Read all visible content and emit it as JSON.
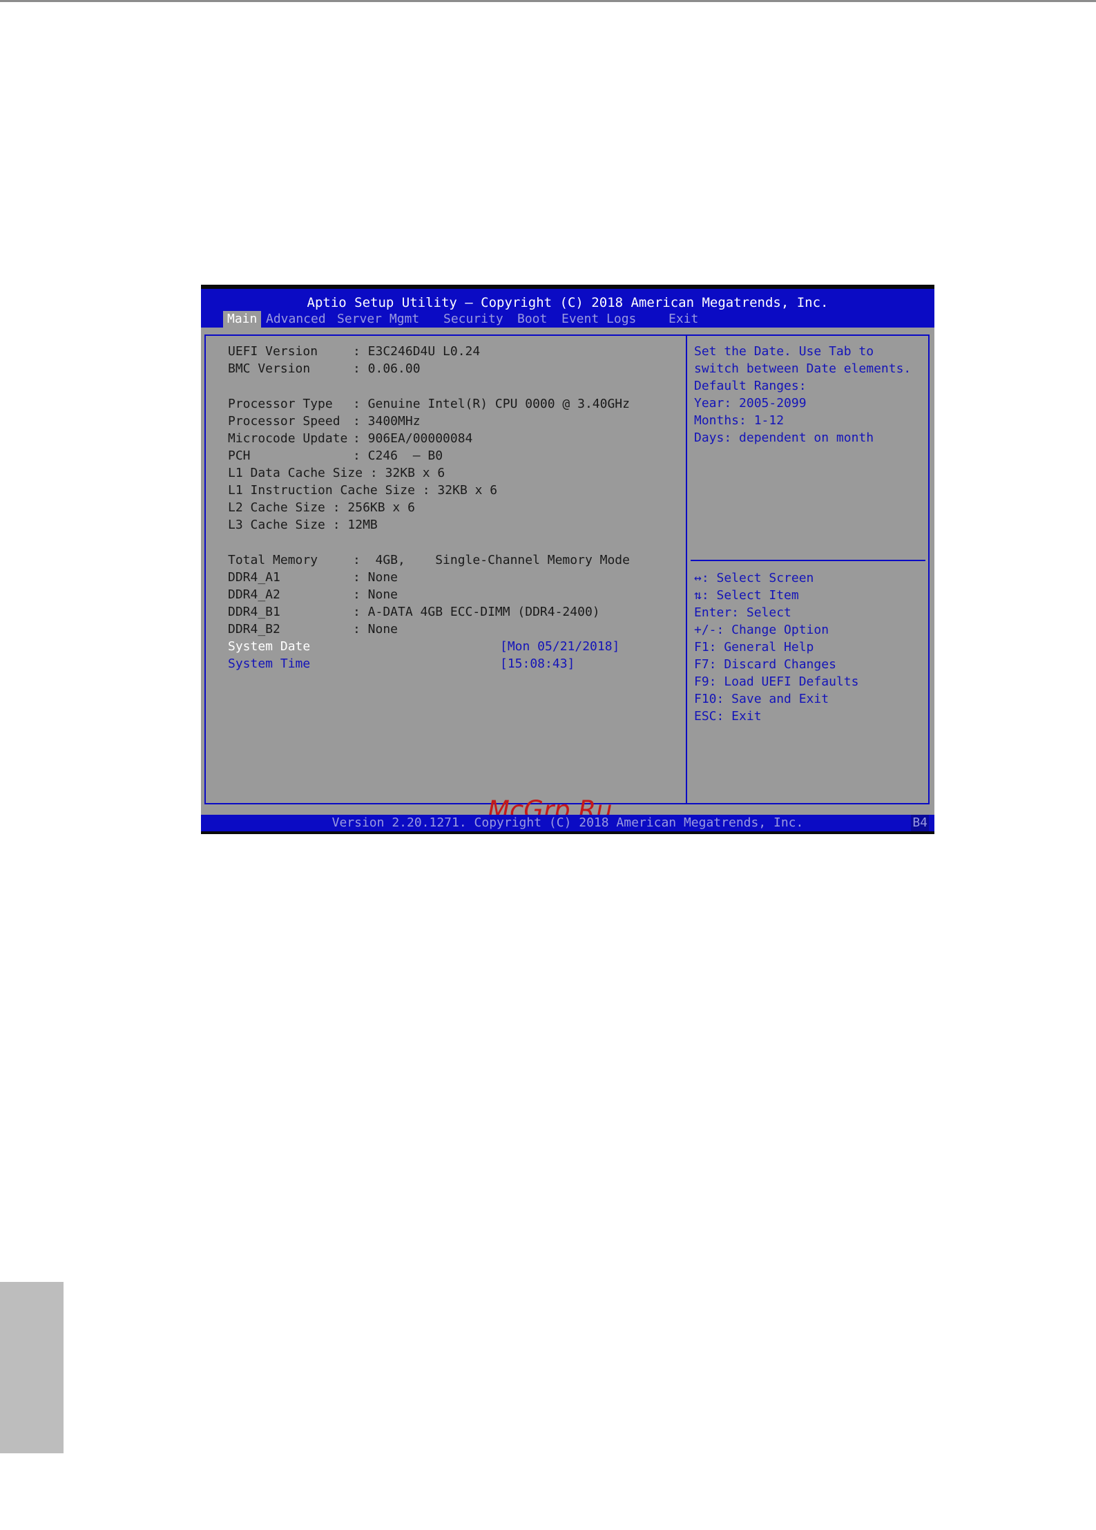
{
  "header": {
    "title": "Aptio Setup Utility – Copyright (C) 2018 American Megatrends, Inc."
  },
  "tabs": [
    {
      "label": "Main",
      "active": true
    },
    {
      "label": "Advanced"
    },
    {
      "label": "Server Mgmt"
    },
    {
      "label": "Security"
    },
    {
      "label": "Boot"
    },
    {
      "label": "Event Logs"
    },
    {
      "label": "Exit"
    }
  ],
  "info": [
    {
      "label": "UEFI Version",
      "value": ": E3C246D4U L0.24"
    },
    {
      "label": "BMC Version",
      "value": ": 0.06.00"
    },
    {
      "label": "Processor Type",
      "value": ": Genuine Intel(R) CPU 0000 @ 3.40GHz"
    },
    {
      "label": "Processor Speed",
      "value": ": 3400MHz"
    },
    {
      "label": "Microcode Update",
      "value": ": 906EA/00000084"
    },
    {
      "label": "PCH",
      "value": ": C246  – B0"
    },
    {
      "label": "L1 Data Cache Size : 32KB x 6"
    },
    {
      "label": "L1 Instruction Cache Size : 32KB x 6"
    },
    {
      "label": "L2 Cache Size : 256KB x 6"
    },
    {
      "label": "L3 Cache Size : 12MB"
    },
    {
      "label": "Total Memory",
      "value": ":  4GB,    Single-Channel Memory Mode"
    },
    {
      "label": "DDR4_A1",
      "value": ": None"
    },
    {
      "label": "DDR4_A2",
      "value": ": None"
    },
    {
      "label": "DDR4_B1",
      "value": ": A-DATA 4GB ECC-DIMM (DDR4-2400)"
    },
    {
      "label": "DDR4_B2",
      "value": ": None"
    }
  ],
  "settings": {
    "system_date": {
      "label": "System Date",
      "value": "[Mon 05/21/2018]"
    },
    "system_time": {
      "label": "System Time",
      "value": "[15:08:43]"
    }
  },
  "help": {
    "description": [
      "Set the Date. Use Tab to",
      "switch between Date elements.",
      "Default Ranges:",
      "Year: 2005-2099",
      "Months: 1-12",
      "Days: dependent on month"
    ],
    "keys": [
      "↔: Select Screen",
      "⇅: Select Item",
      "Enter: Select",
      "+/-: Change Option",
      "F1: General Help",
      "F7: Discard Changes",
      "F9: Load UEFI Defaults",
      "F10: Save and Exit",
      "ESC: Exit"
    ]
  },
  "watermark": "McGrp.Ru",
  "footer": {
    "text": "Version 2.20.1271. Copyright (C) 2018 American Megatrends, Inc.",
    "code": "B4"
  },
  "colors": {
    "bar_blue": "#0b0bc4",
    "panel_gray": "#9a9a9a",
    "link_blue": "#1414b8",
    "watermark_red": "#c41a1a"
  }
}
